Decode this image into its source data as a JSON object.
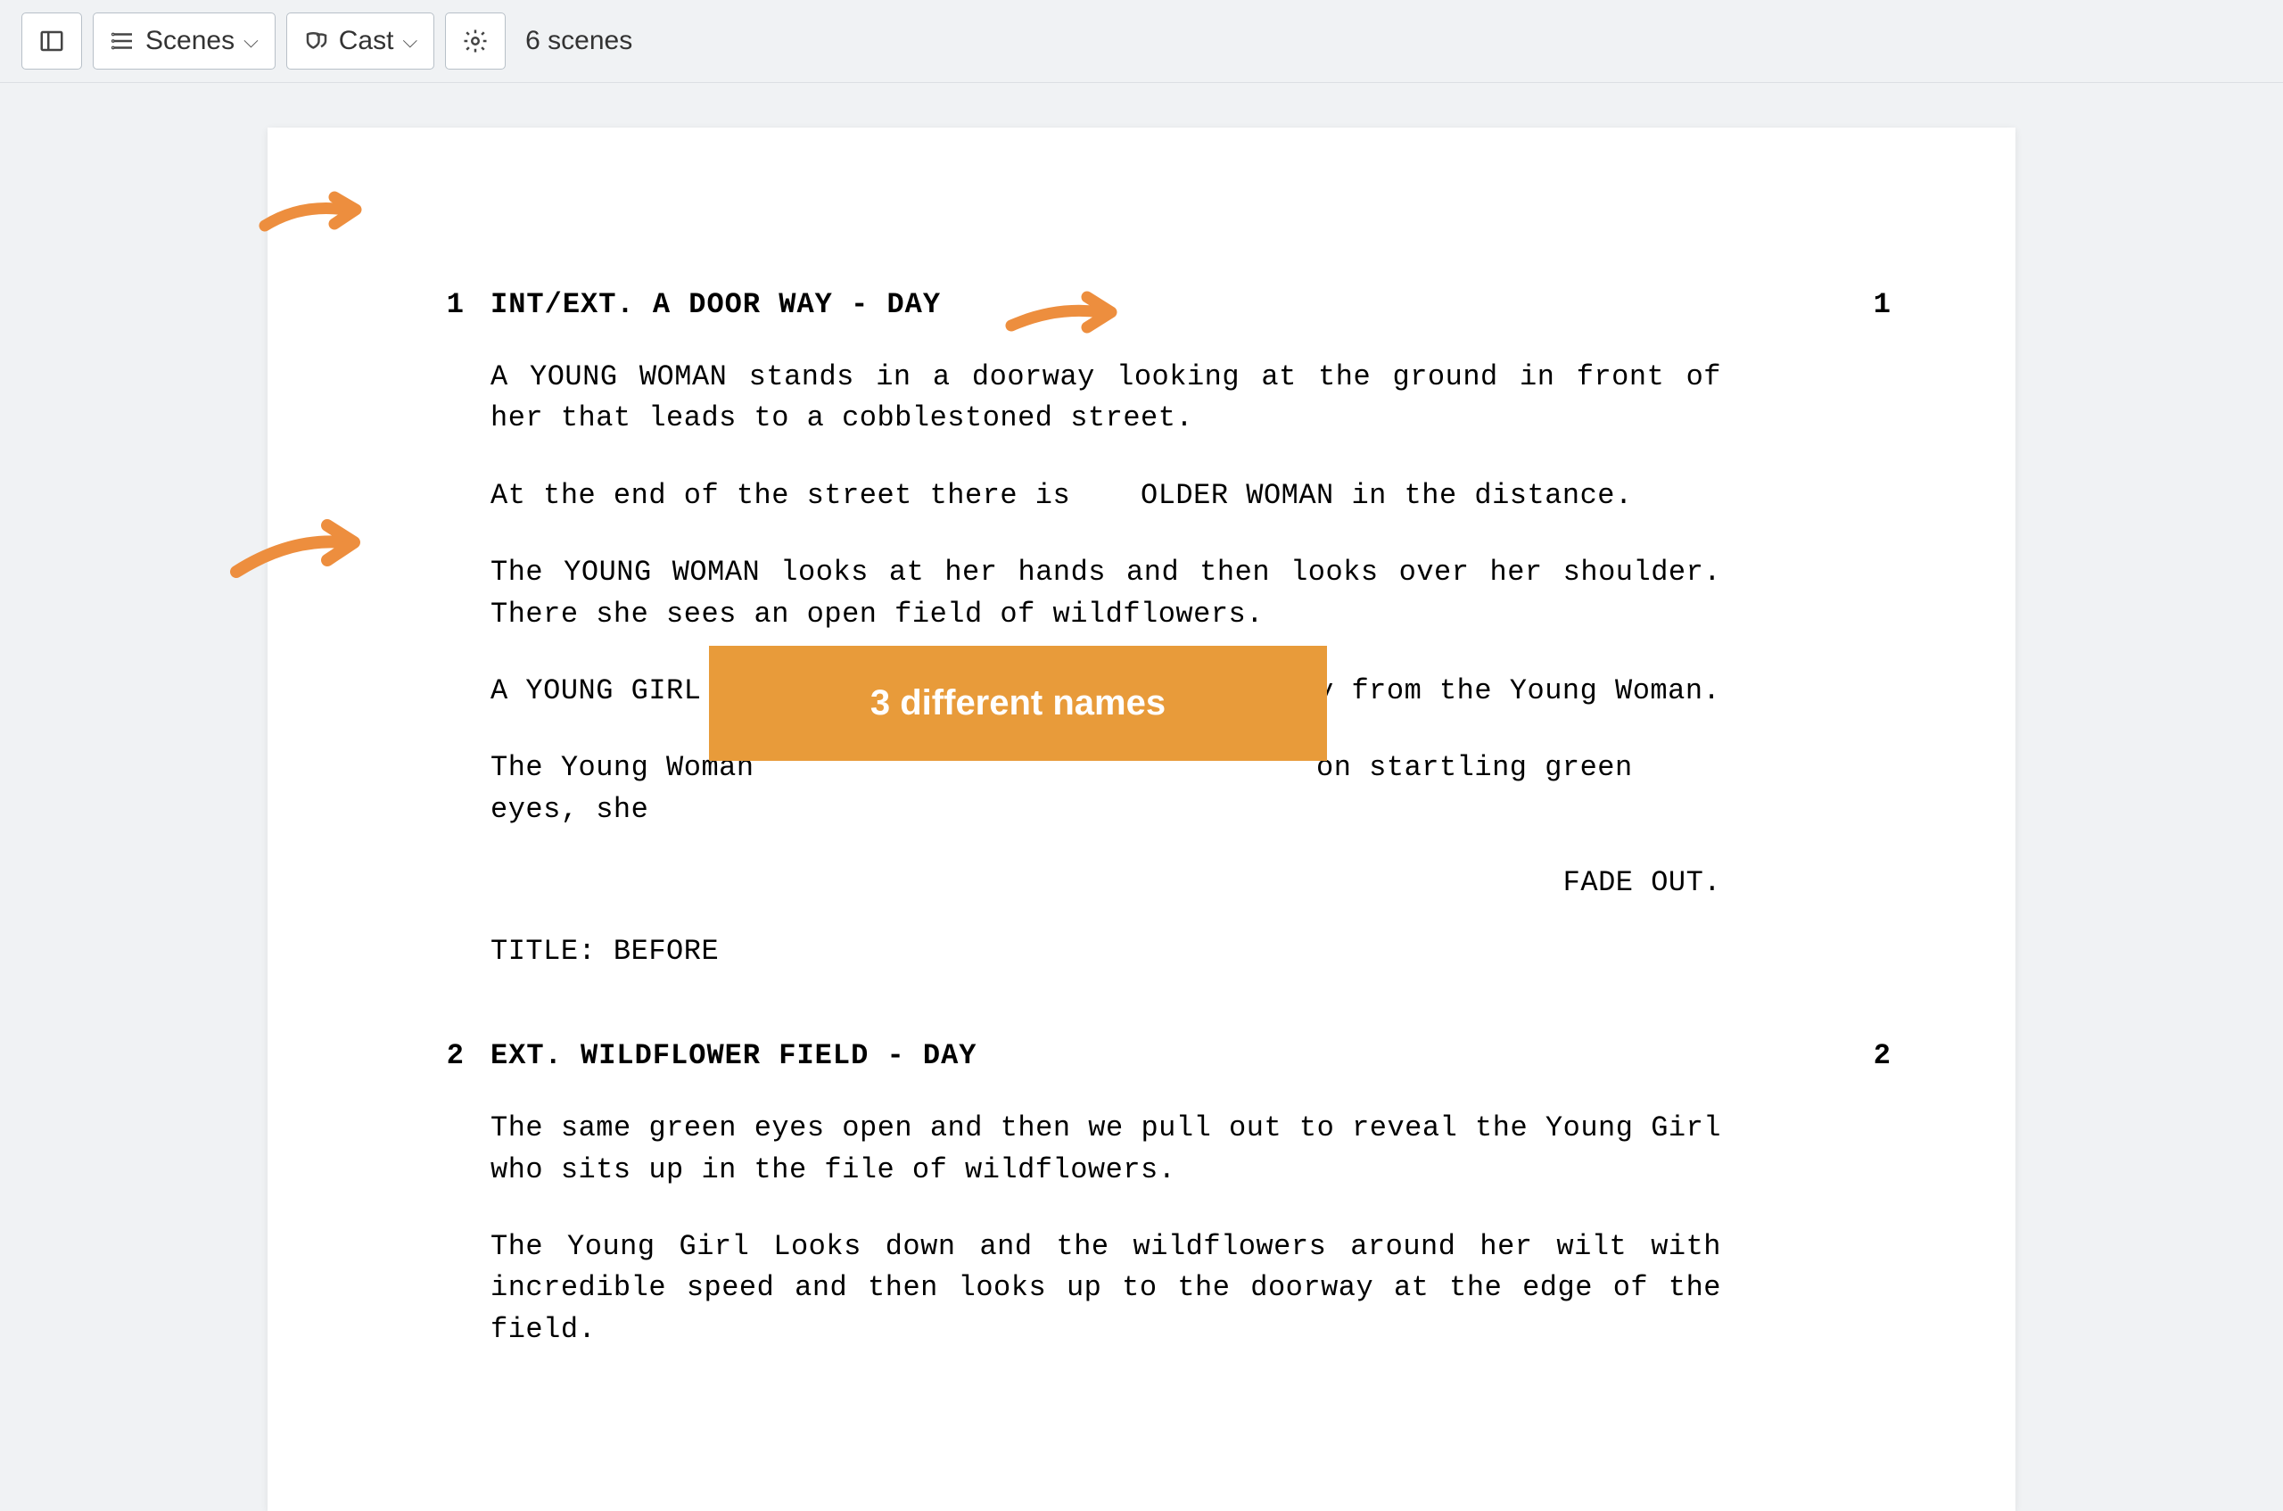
{
  "toolbar": {
    "scenes_label": "Scenes",
    "cast_label": "Cast",
    "status": "6 scenes"
  },
  "annotation": {
    "callout_text": "3 different names"
  },
  "script": {
    "scenes": [
      {
        "number_left": "1",
        "number_right": "1",
        "heading": "INT/EXT. A DOOR WAY - DAY",
        "actions": [
          "A YOUNG WOMAN stands in a doorway looking at the ground in front of her that leads to a cobblestoned street.",
          "At the end of the street there is    OLDER WOMAN in the distance.",
          "The YOUNG WOMAN looks at her hands and then looks over her shoulder. There she sees an open field of wildflowers.",
          "A YOUNG GIRL plays in the distance, looking away from the Young Woman.",
          "The Young Woman                                on startling green eyes, she"
        ],
        "transition": "FADE OUT.",
        "title_line": "TITLE: BEFORE"
      },
      {
        "number_left": "2",
        "number_right": "2",
        "heading": "EXT. WILDFLOWER FIELD - DAY",
        "actions": [
          "The same green eyes open and then we pull out to reveal the Young Girl who sits up in the file of wildflowers.",
          "The Young Girl Looks down and the wildflowers around her wilt with incredible speed and then looks up to the doorway at the edge of the field."
        ]
      }
    ]
  }
}
